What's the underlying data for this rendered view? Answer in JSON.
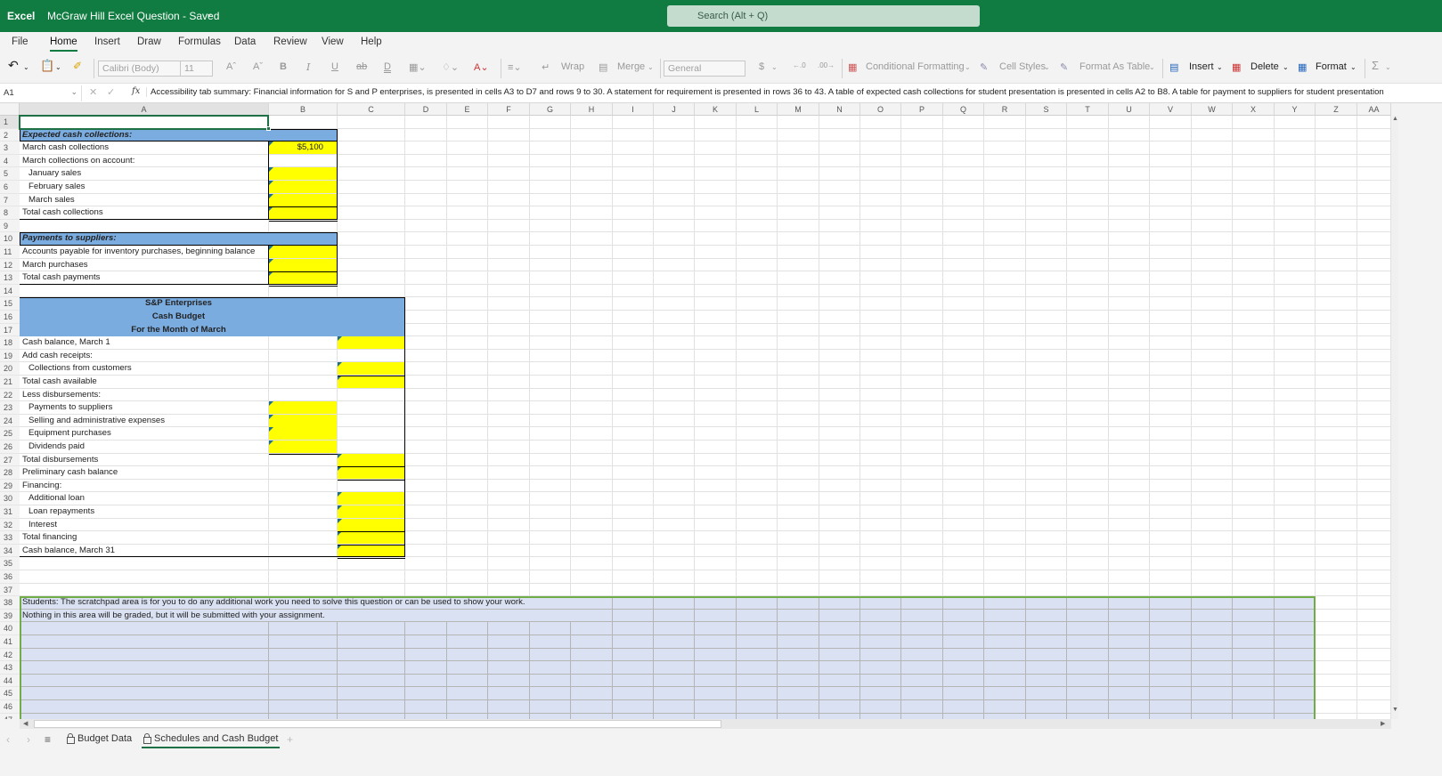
{
  "titlebar": {
    "app_name": "Excel",
    "document_title": "McGraw Hill Excel Question - Saved",
    "search_placeholder": "Search (Alt + Q)"
  },
  "menu": [
    "File",
    "Home",
    "Insert",
    "Draw",
    "Formulas",
    "Data",
    "Review",
    "View",
    "Help"
  ],
  "menu_active": "Home",
  "ribbon": {
    "font_name": "Calibri (Body)",
    "font_size": "11",
    "wrap_label": "Wrap",
    "merge_label": "Merge",
    "number_format": "General",
    "currency_symbol": "$",
    "conditional_formatting": "Conditional Formatting",
    "cell_styles": "Cell Styles",
    "format_as_table": "Format As Table",
    "insert": "Insert",
    "delete": "Delete",
    "format": "Format",
    "sum_symbol": "Σ"
  },
  "formula_bar": {
    "name_box": "A1",
    "fx": "fx",
    "content": "Accessibility tab summary: Financial information for S and P enterprises, is presented in cells A3 to D7 and rows 9 to 30. A statement for requirement is presented in rows 36 to 43. A table of expected cash collections for student presentation is presented in cells A2 to B8. A table for payment to suppliers for student presentation"
  },
  "columns": [
    "A",
    "B",
    "C",
    "D",
    "E",
    "F",
    "G",
    "H",
    "I",
    "J",
    "K",
    "L",
    "M",
    "N",
    "O",
    "P",
    "Q",
    "R",
    "S",
    "T",
    "U",
    "V",
    "W",
    "X",
    "Y",
    "Z",
    "AA"
  ],
  "selected_cell": "A1",
  "cells": {
    "A2": "Expected cash collections:",
    "A3": "March cash collections",
    "B3": "$5,100",
    "A4": "March collections on account:",
    "A5": "January sales",
    "A6": "February sales",
    "A7": "March sales",
    "A8": "Total cash collections",
    "A10": "Payments to suppliers:",
    "A11": "Accounts payable for inventory purchases, beginning balance",
    "A12": "March purchases",
    "A13": "Total cash payments",
    "A15": "S&P Enterprises",
    "A16": "Cash Budget",
    "A17": "For the Month of March",
    "A18": "Cash balance, March 1",
    "A19": "Add cash receipts:",
    "A20": "Collections from customers",
    "A21": "Total cash available",
    "A22": "Less disbursements:",
    "A23": "Payments to suppliers",
    "A24": "Selling and administrative expenses",
    "A25": "Equipment purchases",
    "A26": "Dividends paid",
    "A27": "Total disbursements",
    "A28": "Preliminary cash balance",
    "A29": "Financing:",
    "A30": "Additional loan",
    "A31": "Loan repayments",
    "A32": "Interest",
    "A33": "Total financing",
    "A34": "Cash balance, March 31",
    "A38": "Students: The scratchpad area is for you to do any additional work you need to solve this question or can be used to show your work.",
    "A39": "Nothing in this area will be graded, but it will be submitted with your assignment."
  },
  "input_cells_B": [
    3,
    5,
    6,
    7,
    8,
    11,
    12,
    13,
    23,
    24,
    25,
    26
  ],
  "input_cells_C": [
    18,
    20,
    21,
    27,
    28,
    30,
    31,
    32,
    33,
    34
  ],
  "indented_rows": [
    5,
    6,
    7,
    20,
    23,
    24,
    25,
    26,
    30,
    31,
    32
  ],
  "italic_bold_rows": [
    2,
    10
  ],
  "visible_rows": 47,
  "sheet_tabs": [
    {
      "label": "Budget Data",
      "locked": true,
      "active": false
    },
    {
      "label": "Schedules and Cash Budget",
      "locked": true,
      "active": true
    }
  ],
  "add_sheet": "+",
  "colors": {
    "excel_green": "#107c41",
    "header_blue": "#7aace0",
    "input_yellow": "#ffff00",
    "scratchpad_fill": "#d9e1f2",
    "scratchpad_border": "#70ad47"
  }
}
